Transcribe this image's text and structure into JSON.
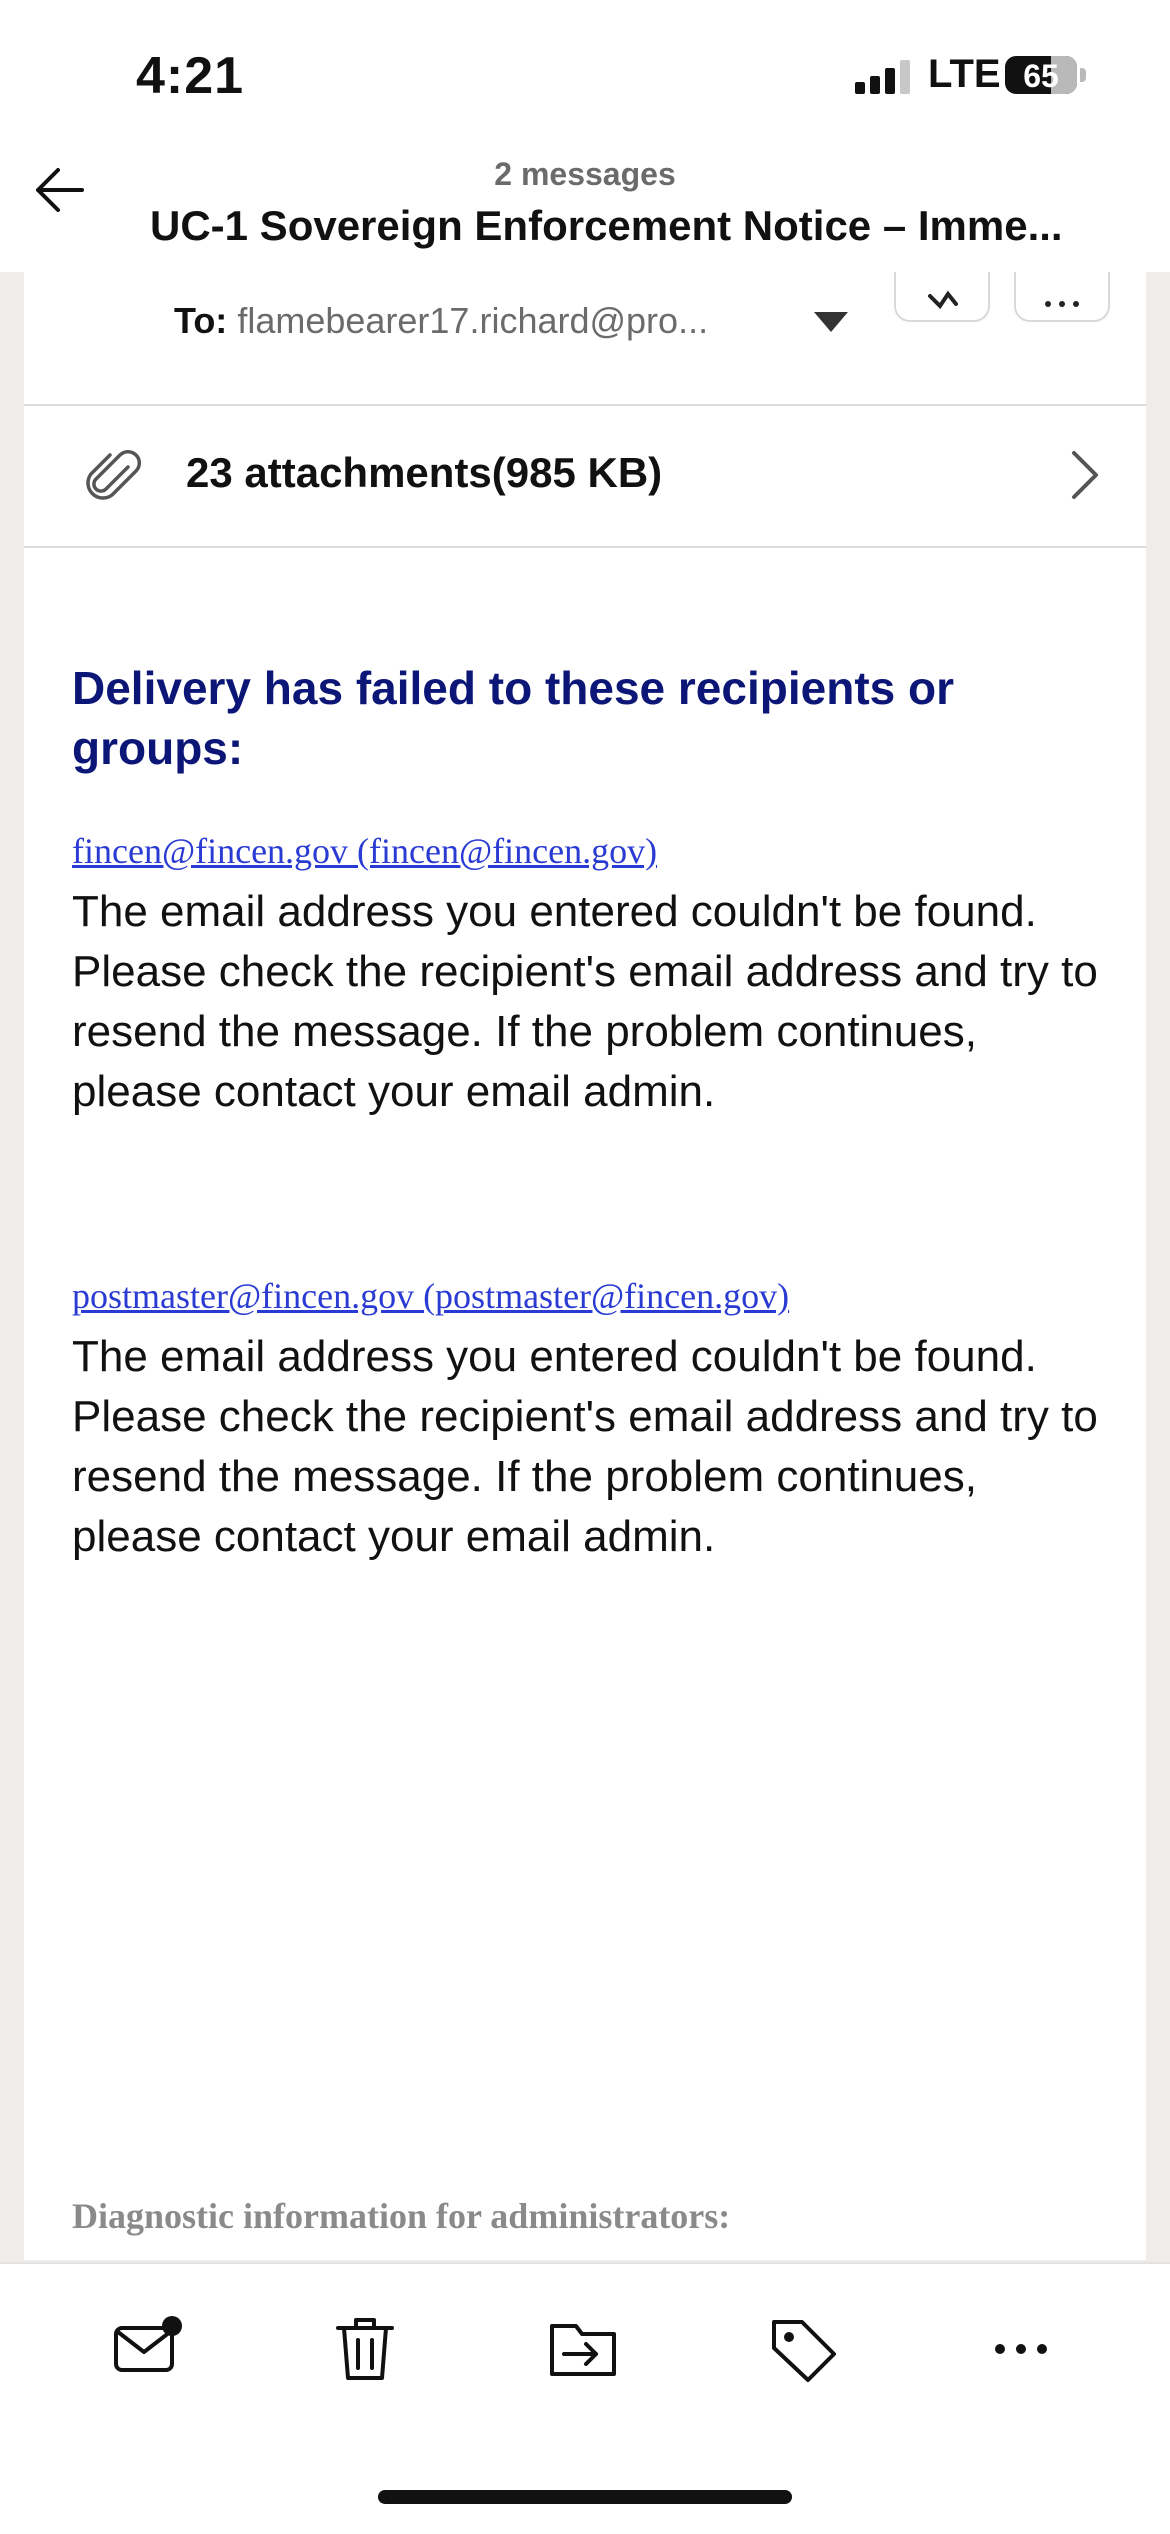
{
  "status_bar": {
    "time": "4:21",
    "network": "LTE",
    "battery": "65"
  },
  "header": {
    "message_count": "2 messages",
    "subject": "UC-1 Sovereign Enforcement Notice – Imme..."
  },
  "recipient": {
    "label": "To:",
    "value": "flamebearer17.richard@pro..."
  },
  "attachments": {
    "label": "23 attachments(985 KB)"
  },
  "body": {
    "heading": "Delivery has failed to these recipients or groups:",
    "failures": [
      {
        "link": "fincen@fincen.gov (fincen@fincen.gov)",
        "message": "The email address you entered couldn't be found. Please check the recipient's email address and try to resend the message. If the problem continues, please contact your email admin."
      },
      {
        "link": "postmaster@fincen.gov (postmaster@fincen.gov)",
        "message": "The email address you entered couldn't be found. Please check the recipient's email address and try to resend the message. If the problem continues, please contact your email admin."
      }
    ],
    "diagnostic_heading": "Diagnostic information for administrators:"
  },
  "toolbar": {
    "icons": [
      "mark-unread-icon",
      "trash-icon",
      "move-to-folder-icon",
      "tag-icon",
      "more-icon"
    ]
  },
  "colors": {
    "heading": "#0b1677",
    "link": "#2a3bd3",
    "muted": "#6b6b6b"
  }
}
